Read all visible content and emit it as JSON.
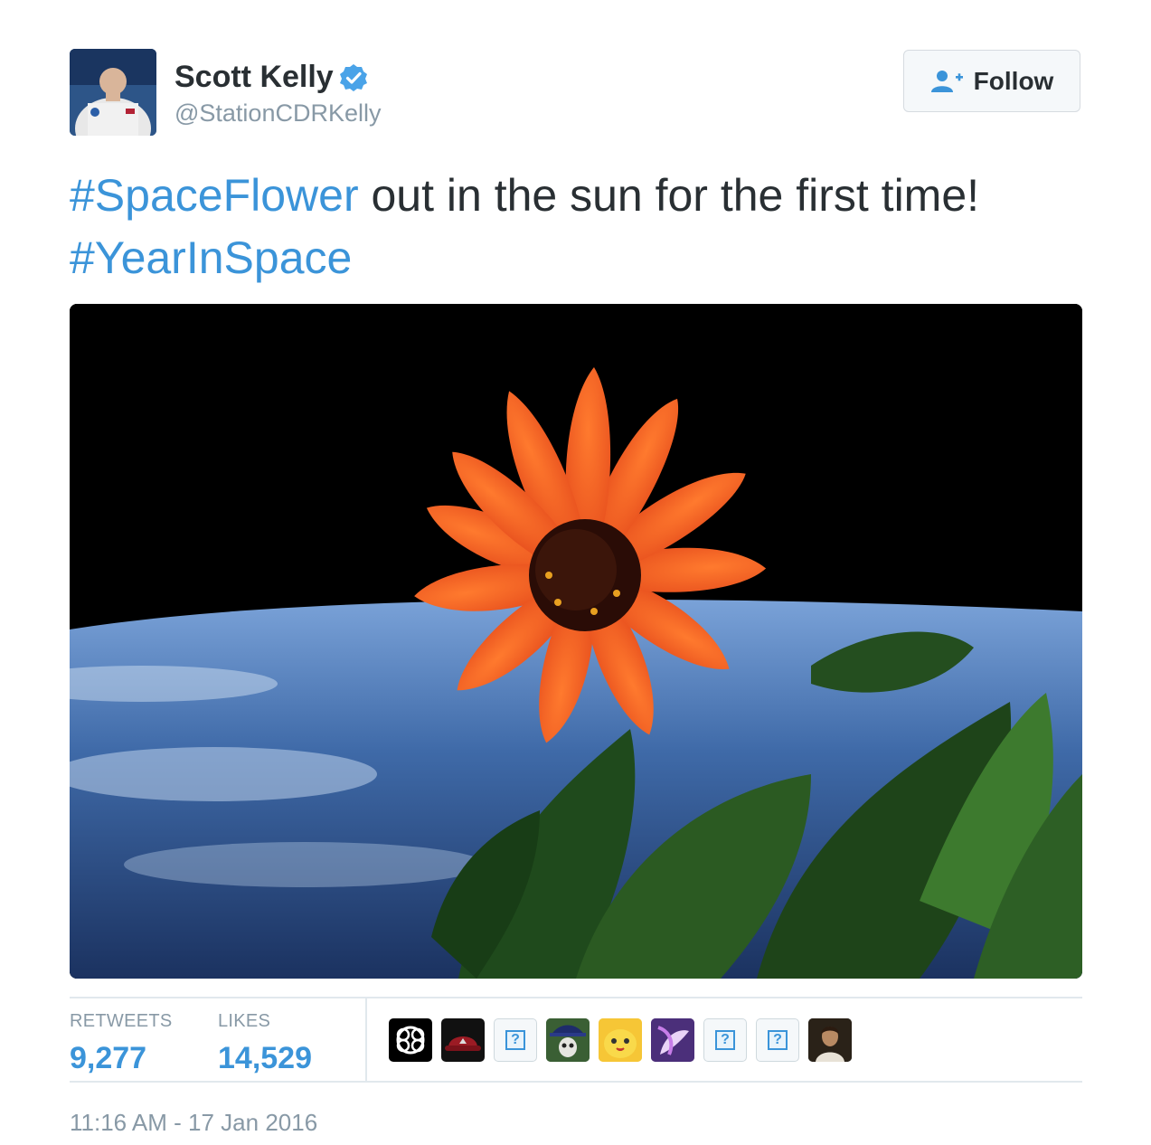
{
  "author": {
    "name": "Scott Kelly",
    "handle": "@StationCDRKelly",
    "verified": true
  },
  "follow_button": {
    "label": "Follow",
    "icon": "add-user-icon"
  },
  "tweet": {
    "hashtag1": "#SpaceFlower",
    "text": " out in the sun for the first time!",
    "hashtag2": "#YearInSpace"
  },
  "stats": {
    "retweets_label": "RETWEETS",
    "retweets_value": "9,277",
    "likes_label": "LIKES",
    "likes_value": "14,529"
  },
  "likers": [
    "knot-logo-avatar",
    "red-cap-avatar",
    "unknown-avatar",
    "skull-hat-avatar",
    "yellow-character-avatar",
    "purple-unicorn-avatar",
    "unknown-avatar",
    "unknown-avatar",
    "person-avatar"
  ],
  "timestamp": "11:16 AM - 17 Jan 2016",
  "colors": {
    "link": "#3b94d9",
    "text": "#292f33",
    "muted": "#8899a6"
  }
}
